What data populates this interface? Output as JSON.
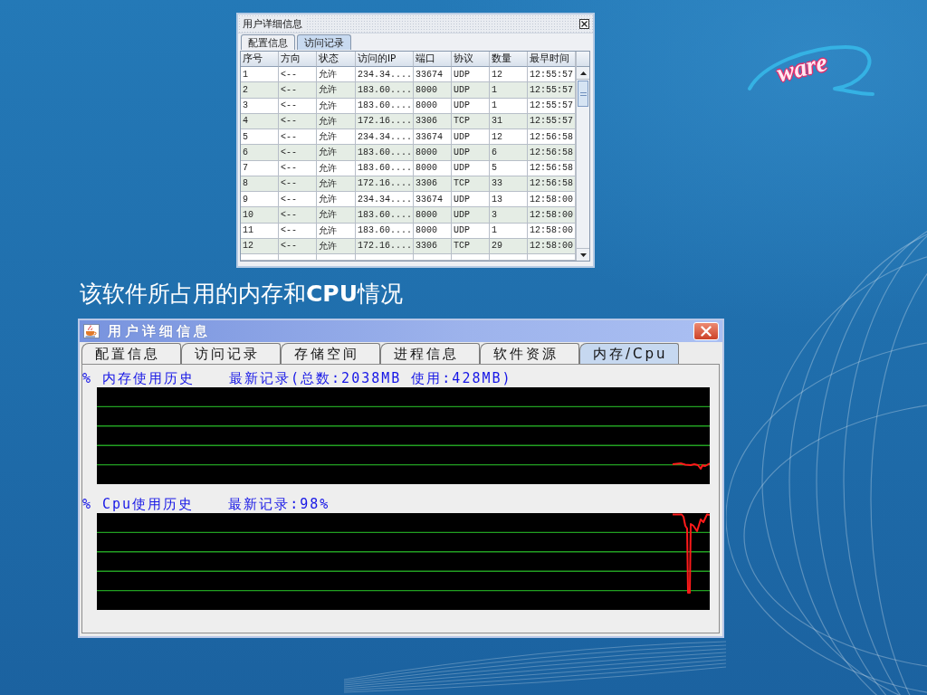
{
  "access_window": {
    "title": "用户详细信息",
    "tabs": [
      {
        "label": "配置信息",
        "selected": false
      },
      {
        "label": "访问记录",
        "selected": true
      }
    ],
    "table": {
      "columns": [
        "序号",
        "方向",
        "状态",
        "访问的IP",
        "端口",
        "协议",
        "数量",
        "最早时间"
      ],
      "rows": [
        [
          "1",
          "<--",
          "允许",
          "234.34....",
          "33674",
          "UDP",
          "12",
          "12:55:57"
        ],
        [
          "2",
          "<--",
          "允许",
          "183.60....",
          "8000",
          "UDP",
          "1",
          "12:55:57"
        ],
        [
          "3",
          "<--",
          "允许",
          "183.60....",
          "8000",
          "UDP",
          "1",
          "12:55:57"
        ],
        [
          "4",
          "<--",
          "允许",
          "172.16....",
          "3306",
          "TCP",
          "31",
          "12:55:57"
        ],
        [
          "5",
          "<--",
          "允许",
          "234.34....",
          "33674",
          "UDP",
          "12",
          "12:56:58"
        ],
        [
          "6",
          "<--",
          "允许",
          "183.60....",
          "8000",
          "UDP",
          "6",
          "12:56:58"
        ],
        [
          "7",
          "<--",
          "允许",
          "183.60....",
          "8000",
          "UDP",
          "5",
          "12:56:58"
        ],
        [
          "8",
          "<--",
          "允许",
          "172.16....",
          "3306",
          "TCP",
          "33",
          "12:56:58"
        ],
        [
          "9",
          "<--",
          "允许",
          "234.34....",
          "33674",
          "UDP",
          "13",
          "12:58:00"
        ],
        [
          "10",
          "<--",
          "允许",
          "183.60....",
          "8000",
          "UDP",
          "3",
          "12:58:00"
        ],
        [
          "11",
          "<--",
          "允许",
          "183.60....",
          "8000",
          "UDP",
          "1",
          "12:58:00"
        ],
        [
          "12",
          "<--",
          "允许",
          "172.16....",
          "3306",
          "TCP",
          "29",
          "12:58:00"
        ]
      ]
    }
  },
  "logo": {
    "text": "ware"
  },
  "caption": "该软件所占用的内存和**CPU**情况",
  "resource_window": {
    "title": "用户详细信息",
    "tabs": [
      {
        "label": "配置信息",
        "selected": false
      },
      {
        "label": "访问记录",
        "selected": false
      },
      {
        "label": "存储空间",
        "selected": false
      },
      {
        "label": "进程信息",
        "selected": false
      },
      {
        "label": "软件资源",
        "selected": false
      },
      {
        "label": "内存/Cpu",
        "selected": true
      }
    ],
    "panels": [
      {
        "kind": "memory",
        "label": "% 内存使用历史",
        "reading": "最新记录(总数:2038MB 使用:428MB)"
      },
      {
        "kind": "cpu",
        "label": "% Cpu使用历史",
        "reading": "最新记录:98%"
      }
    ]
  }
}
